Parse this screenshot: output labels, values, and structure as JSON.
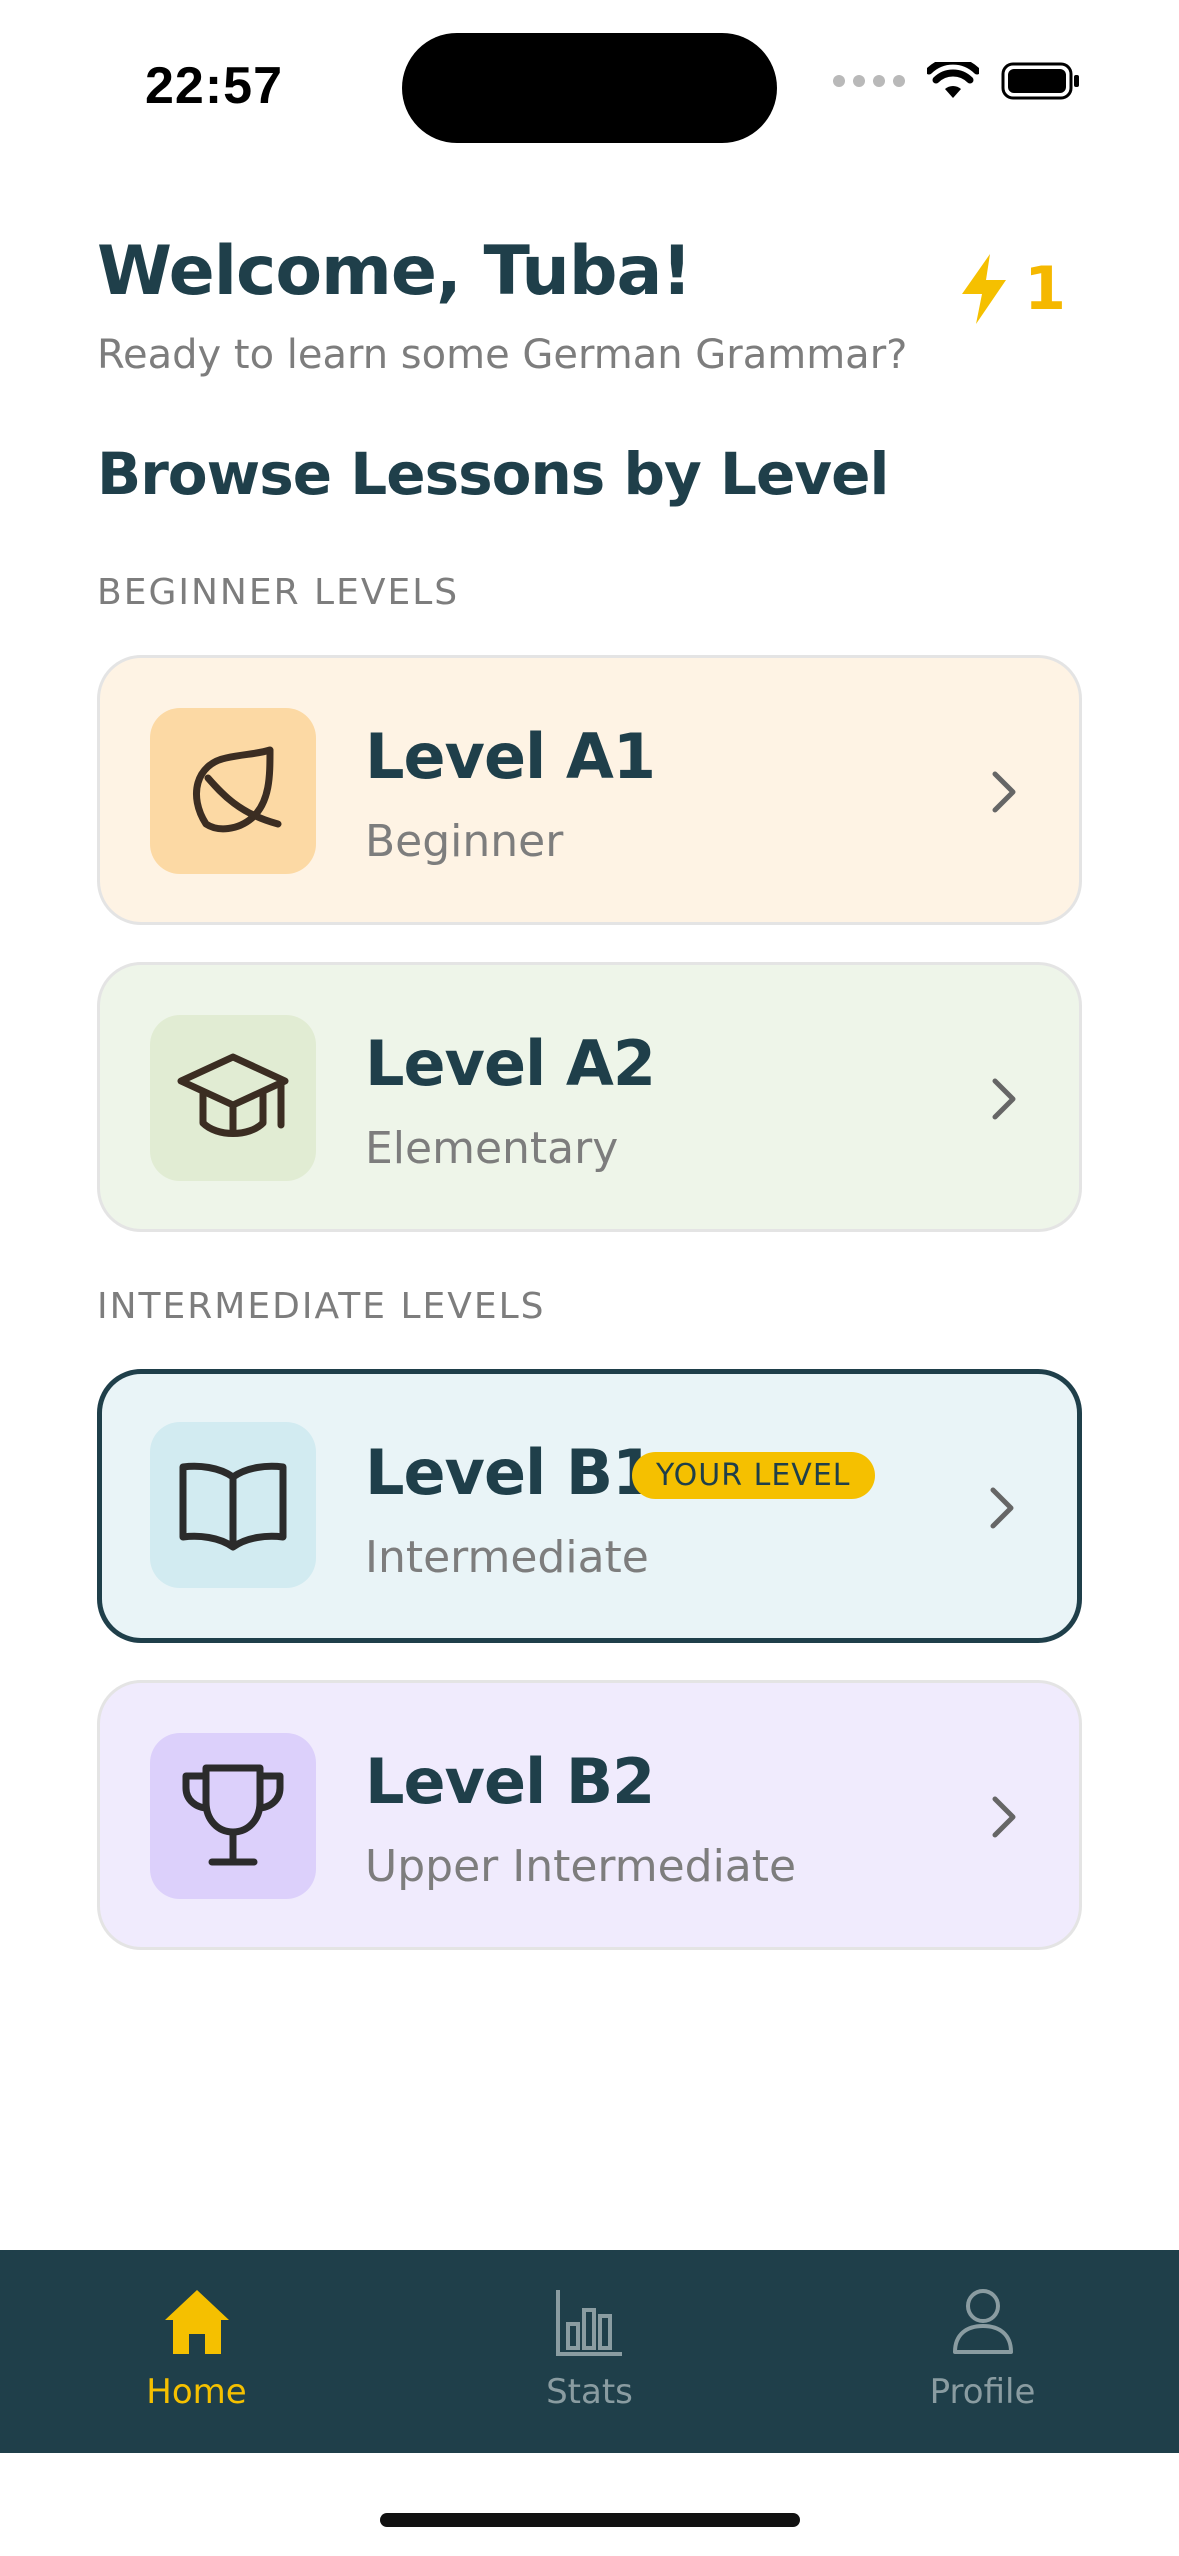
{
  "status_bar": {
    "time": "22:57"
  },
  "header": {
    "welcome": "Welcome, Tuba!",
    "subtitle": "Ready to learn some German Grammar?",
    "streak_count": "1"
  },
  "browse_title": "Browse Lessons by Level",
  "sections": {
    "beginner": "BEGINNER LEVELS",
    "intermediate": "INTERMEDIATE LEVELS"
  },
  "levels": [
    {
      "title": "Level A1",
      "subtitle": "Beginner",
      "icon": "leaf-icon",
      "bg": "#fef3e4",
      "icon_bg": "#fcd9a4"
    },
    {
      "title": "Level A2",
      "subtitle": "Elementary",
      "icon": "graduation-cap-icon",
      "bg": "#eef5e9",
      "icon_bg": "#e1ecd3"
    },
    {
      "title": "Level B1",
      "subtitle": "Intermediate",
      "icon": "open-book-icon",
      "bg": "#e9f4f7",
      "icon_bg": "#d2ebf1",
      "badge": "YOUR LEVEL"
    },
    {
      "title": "Level B2",
      "subtitle": "Upper Intermediate",
      "icon": "trophy-icon",
      "bg": "#f0ebfd",
      "icon_bg": "#dcd0fb"
    }
  ],
  "tabs": [
    {
      "label": "Home",
      "icon": "home-icon",
      "active": true
    },
    {
      "label": "Stats",
      "icon": "bar-chart-icon",
      "active": false
    },
    {
      "label": "Profile",
      "icon": "person-icon",
      "active": false
    }
  ],
  "colors": {
    "primary": "#1f3f4a",
    "accent": "#f5c000",
    "muted_text": "#7d7d7d"
  }
}
